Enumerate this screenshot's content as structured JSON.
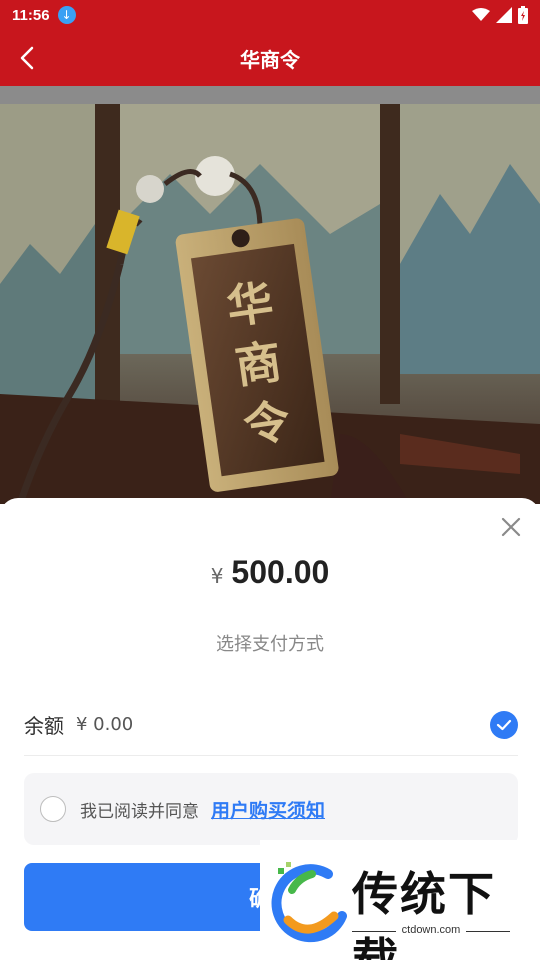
{
  "status": {
    "time": "11:56",
    "download_icon": "download-icon",
    "wifi_icon": "wifi-icon",
    "signal_icon": "signal-icon",
    "battery_icon": "battery-icon"
  },
  "nav": {
    "title": "华商令",
    "back_icon": "chevron-left-icon"
  },
  "hero": {
    "token_text": [
      "华",
      "商",
      "令"
    ]
  },
  "sheet": {
    "close_icon": "close-icon",
    "currency": "¥",
    "amount": "500.00",
    "pay_method_title": "选择支付方式",
    "balance": {
      "label": "余额",
      "value": "¥ 0.00",
      "selected": true
    },
    "agree": {
      "text": "我已阅读并同意",
      "link": "用户购买须知",
      "checked": false
    },
    "confirm_label": "确认"
  },
  "watermark": {
    "brand": "传统下载",
    "domain": "ctdown.com"
  },
  "colors": {
    "brand_red": "#c8161d",
    "accent_blue": "#2f7bf5"
  }
}
